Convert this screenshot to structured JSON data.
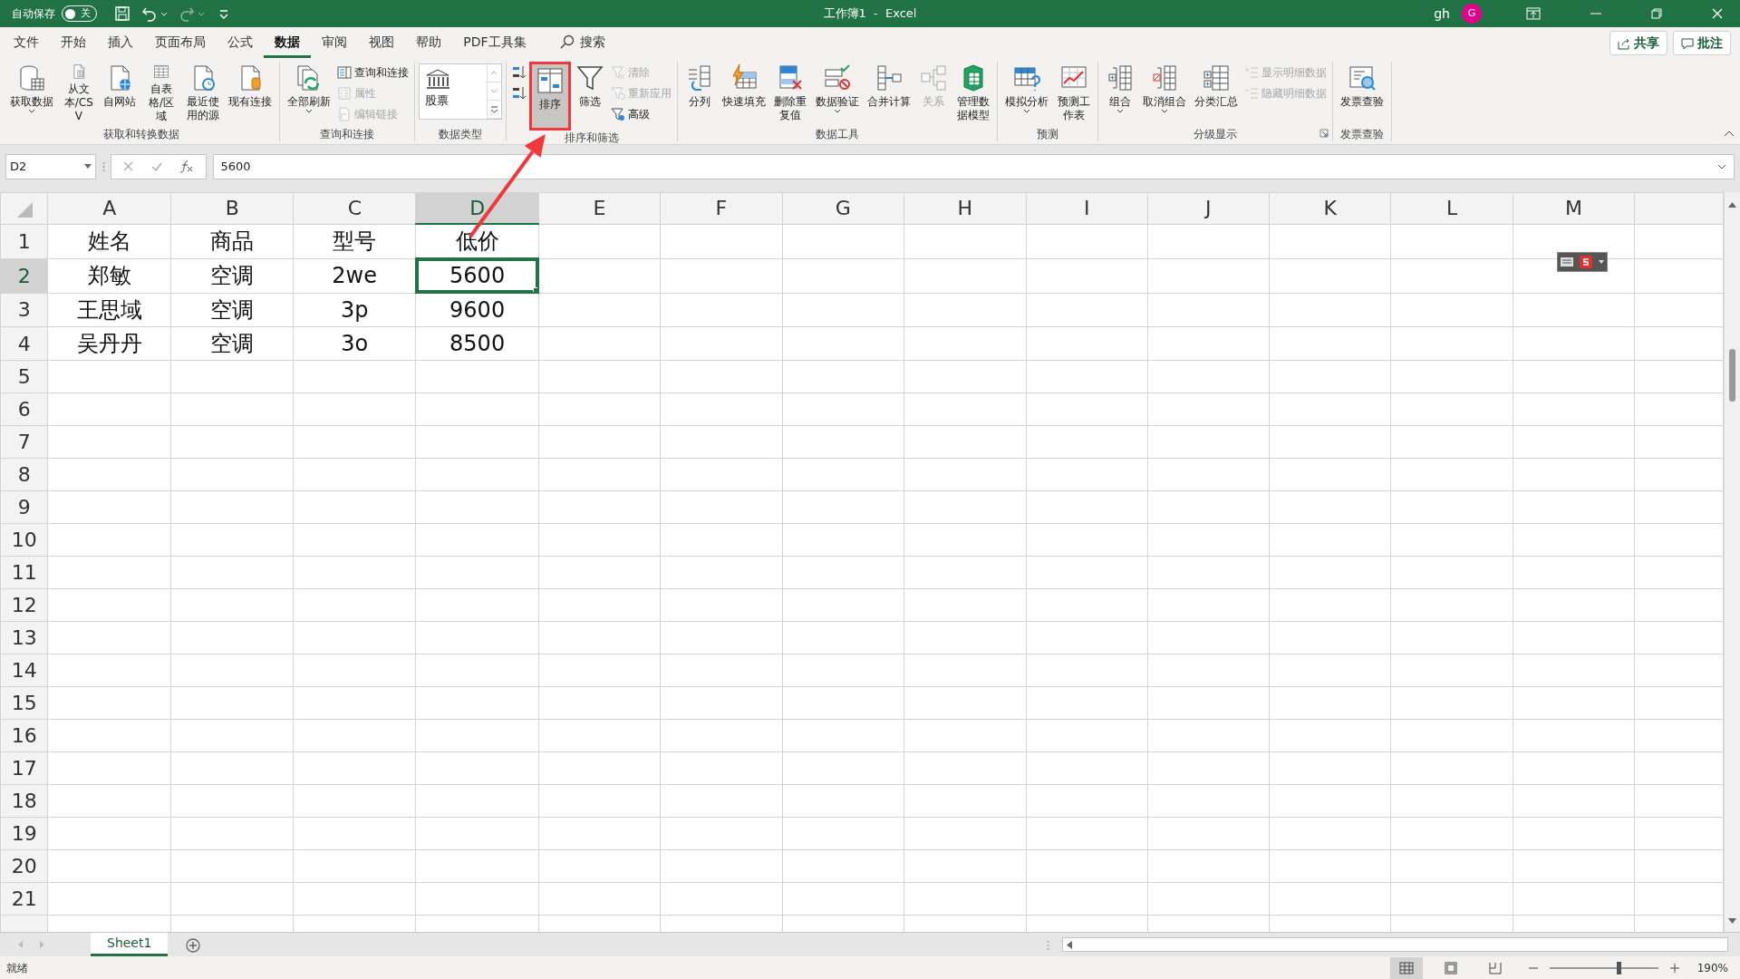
{
  "title_bar": {
    "autosave_label": "自动保存",
    "autosave_state": "关",
    "autosave_on": false,
    "title": "工作簿1  -  Excel",
    "user": "gh",
    "avatar": "G"
  },
  "quick_access": [
    {
      "kind": "save",
      "disabled": false
    },
    {
      "kind": "undo",
      "disabled": false
    },
    {
      "kind": "redo",
      "disabled": true
    },
    {
      "kind": "customize",
      "disabled": false
    }
  ],
  "menu_tabs": [
    {
      "label": "文件",
      "selected": false
    },
    {
      "label": "开始",
      "selected": false
    },
    {
      "label": "插入",
      "selected": false
    },
    {
      "label": "页面布局",
      "selected": false
    },
    {
      "label": "公式",
      "selected": false
    },
    {
      "label": "数据",
      "selected": true
    },
    {
      "label": "审阅",
      "selected": false
    },
    {
      "label": "视图",
      "selected": false
    },
    {
      "label": "帮助",
      "selected": false
    },
    {
      "label": "PDF工具集",
      "selected": false
    }
  ],
  "search": {
    "label": "搜索"
  },
  "share_button": "共享",
  "comment_button": "批注",
  "ribbon_groups": [
    {
      "title": "获取和转换数据",
      "items": [
        {
          "kind": "large",
          "label": "获取数据",
          "dropdown": true,
          "disabled": false
        },
        {
          "kind": "large",
          "label": "从文本/CSV",
          "disabled": false
        },
        {
          "kind": "large",
          "label": "自网站",
          "disabled": false
        },
        {
          "kind": "large",
          "label": "自表格/区域",
          "disabled": false
        },
        {
          "kind": "large",
          "label": "最近使用的源",
          "disabled": false
        },
        {
          "kind": "large",
          "label": "现有连接",
          "disabled": false
        }
      ]
    },
    {
      "title": "查询和连接",
      "items": [
        {
          "kind": "large",
          "label": "全部刷新",
          "dropdown": true,
          "disabled": false
        },
        {
          "kind": "small",
          "label": "查询和连接",
          "disabled": false
        },
        {
          "kind": "small",
          "label": "属性",
          "disabled": true
        },
        {
          "kind": "small",
          "label": "编辑链接",
          "disabled": true
        }
      ]
    },
    {
      "title": "数据类型",
      "items": [
        {
          "kind": "gallery",
          "label": "股票"
        }
      ]
    },
    {
      "title": "排序和筛选",
      "items": [
        {
          "kind": "icon"
        },
        {
          "kind": "icon"
        },
        {
          "kind": "large",
          "label": "排序",
          "disabled": false,
          "highlighted": true
        },
        {
          "kind": "large",
          "label": "筛选",
          "disabled": false
        },
        {
          "kind": "small",
          "label": "清除",
          "disabled": true
        },
        {
          "kind": "small",
          "label": "重新应用",
          "disabled": true
        },
        {
          "kind": "small",
          "label": "高级",
          "disabled": false
        }
      ]
    },
    {
      "title": "数据工具",
      "items": [
        {
          "kind": "large",
          "label": "分列",
          "disabled": false
        },
        {
          "kind": "large",
          "label": "快速填充",
          "disabled": false
        },
        {
          "kind": "large",
          "label": "删除重复值",
          "disabled": false
        },
        {
          "kind": "large",
          "label": "数据验证",
          "dropdown": true,
          "disabled": false
        },
        {
          "kind": "large",
          "label": "合并计算",
          "disabled": false
        },
        {
          "kind": "large",
          "label": "关系",
          "disabled": true
        },
        {
          "kind": "large",
          "label": "管理数据模型",
          "disabled": false
        }
      ]
    },
    {
      "title": "预测",
      "items": [
        {
          "kind": "large",
          "label": "模拟分析",
          "dropdown": true,
          "disabled": false
        },
        {
          "kind": "large",
          "label": "预测工作表",
          "disabled": false
        }
      ]
    },
    {
      "title": "分级显示",
      "launcher": true,
      "items": [
        {
          "kind": "large",
          "label": "组合",
          "dropdown": true,
          "disabled": false
        },
        {
          "kind": "large",
          "label": "取消组合",
          "dropdown": true,
          "disabled": false
        },
        {
          "kind": "large",
          "label": "分类汇总",
          "disabled": false
        },
        {
          "kind": "small",
          "label": "显示明细数据",
          "disabled": true
        },
        {
          "kind": "small",
          "label": "隐藏明细数据",
          "disabled": true
        }
      ]
    },
    {
      "title": "发票查验",
      "items": [
        {
          "kind": "large",
          "label": "发票查验",
          "disabled": false
        }
      ]
    }
  ],
  "formula_bar": {
    "name_box": "D2",
    "formula": "5600"
  },
  "sheet": {
    "columns": [
      "A",
      "B",
      "C",
      "D",
      "E",
      "F",
      "G",
      "H",
      "I",
      "J",
      "K",
      "L",
      "M"
    ],
    "rows": [
      {
        "header": "1",
        "cells": [
          {
            "text": "姓名",
            "selected": false
          },
          {
            "text": "商品",
            "selected": false
          },
          {
            "text": "型号",
            "selected": false
          },
          {
            "text": "低价",
            "selected": false
          }
        ]
      },
      {
        "header": "2",
        "cells": [
          {
            "text": "郑敏",
            "selected": false
          },
          {
            "text": "空调",
            "selected": false
          },
          {
            "text": "2we",
            "selected": false
          },
          {
            "text": "5600",
            "selected": true
          }
        ]
      },
      {
        "header": "3",
        "cells": [
          {
            "text": "王思域",
            "selected": false
          },
          {
            "text": "空调",
            "selected": false
          },
          {
            "text": "3p",
            "selected": false
          },
          {
            "text": "9600",
            "selected": false
          }
        ]
      },
      {
        "header": "4",
        "cells": [
          {
            "text": "吴丹丹",
            "selected": false
          },
          {
            "text": "空调",
            "selected": false
          },
          {
            "text": "3o",
            "selected": false
          },
          {
            "text": "8500",
            "selected": false
          }
        ]
      },
      {
        "header": "5",
        "cells": []
      },
      {
        "header": "6",
        "cells": []
      },
      {
        "header": "7",
        "cells": []
      },
      {
        "header": "8",
        "cells": []
      },
      {
        "header": "9",
        "cells": []
      },
      {
        "header": "10",
        "cells": []
      },
      {
        "header": "11",
        "cells": []
      },
      {
        "header": "12",
        "cells": []
      },
      {
        "header": "13",
        "cells": []
      },
      {
        "header": "14",
        "cells": []
      },
      {
        "header": "15",
        "cells": []
      },
      {
        "header": "16",
        "cells": []
      },
      {
        "header": "17",
        "cells": []
      },
      {
        "header": "18",
        "cells": []
      },
      {
        "header": "19",
        "cells": []
      },
      {
        "header": "20",
        "cells": []
      },
      {
        "header": "21",
        "cells": []
      }
    ]
  },
  "sheet_tabs": [
    {
      "label": "Sheet1",
      "selected": true
    }
  ],
  "status_bar": {
    "status": "就绪",
    "views": [
      {
        "kind": "normal",
        "selected": true
      },
      {
        "kind": "layout",
        "selected": false
      },
      {
        "kind": "pagebreak",
        "selected": false
      }
    ],
    "zoom": {
      "level": 0.63,
      "reading": "190%"
    }
  }
}
